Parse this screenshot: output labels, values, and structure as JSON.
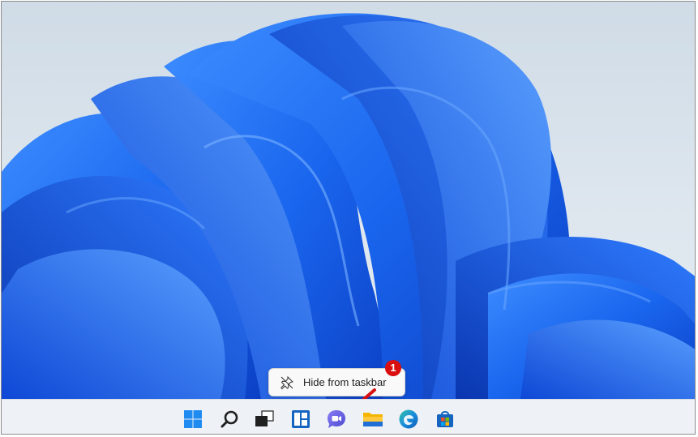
{
  "desktop": {
    "wallpaper": "windows-11-bloom-wallpaper",
    "colors": {
      "background": "#dde6ee",
      "bloom_dark": "#0b3fc4",
      "bloom_mid": "#1a66ee",
      "bloom_light": "#3d8cff"
    }
  },
  "context_menu": {
    "items": [
      {
        "label": "Hide from taskbar",
        "icon": "unpin-icon"
      }
    ]
  },
  "annotation": {
    "step_number": "1",
    "badge_color": "#d90f0f",
    "arrow_color": "#d90f0f"
  },
  "taskbar": {
    "background": "#eef2f6",
    "icons": [
      {
        "name": "start-icon"
      },
      {
        "name": "search-icon"
      },
      {
        "name": "task-view-icon"
      },
      {
        "name": "widgets-icon"
      },
      {
        "name": "chat-icon"
      },
      {
        "name": "file-explorer-icon"
      },
      {
        "name": "edge-icon"
      },
      {
        "name": "store-icon"
      }
    ]
  }
}
